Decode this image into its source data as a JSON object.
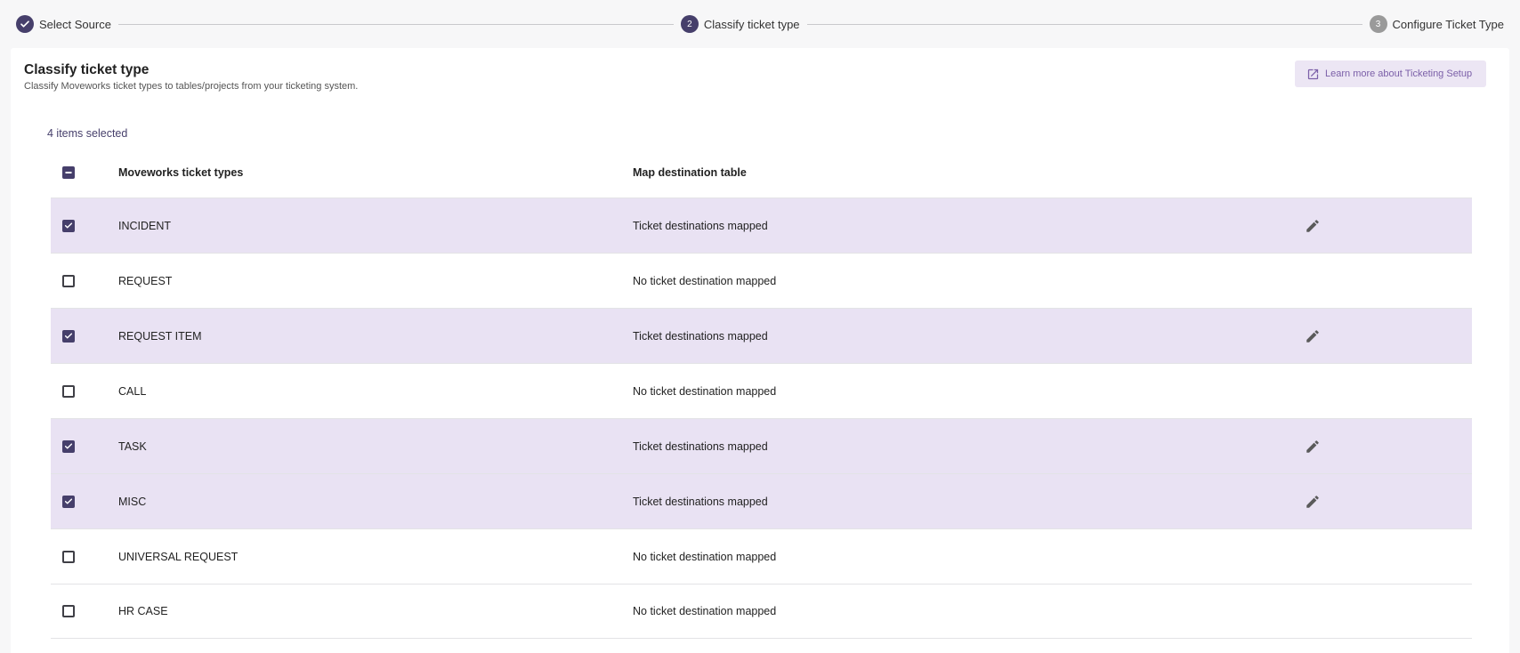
{
  "stepper": {
    "steps": [
      {
        "label": "Select Source",
        "status": "done",
        "number": ""
      },
      {
        "label": "Classify ticket type",
        "status": "active",
        "number": "2"
      },
      {
        "label": "Configure Ticket Type",
        "status": "pending",
        "number": "3"
      }
    ]
  },
  "card": {
    "title": "Classify ticket type",
    "subtitle": "Classify Moveworks ticket types to tables/projects from your ticketing system.",
    "learn_more_label": "Learn more about Ticketing Setup"
  },
  "selection": {
    "count_label": "4 items selected"
  },
  "table": {
    "headers": {
      "type": "Moveworks ticket types",
      "destination": "Map destination table"
    },
    "rows": [
      {
        "type": "INCIDENT",
        "destination": "Ticket destinations mapped",
        "checked": true
      },
      {
        "type": "REQUEST",
        "destination": "No ticket destination mapped",
        "checked": false
      },
      {
        "type": "REQUEST ITEM",
        "destination": "Ticket destinations mapped",
        "checked": true
      },
      {
        "type": "CALL",
        "destination": "No ticket destination mapped",
        "checked": false
      },
      {
        "type": "TASK",
        "destination": "Ticket destinations mapped",
        "checked": true
      },
      {
        "type": "MISC",
        "destination": "Ticket destinations mapped",
        "checked": true
      },
      {
        "type": "UNIVERSAL REQUEST",
        "destination": "No ticket destination mapped",
        "checked": false
      },
      {
        "type": "HR CASE",
        "destination": "No ticket destination mapped",
        "checked": false
      }
    ]
  },
  "colors": {
    "primary": "#463f6b",
    "selected_row": "#e9e2f3",
    "learn_button_bg": "#ece6f4",
    "learn_button_text": "#7b5fa8"
  }
}
